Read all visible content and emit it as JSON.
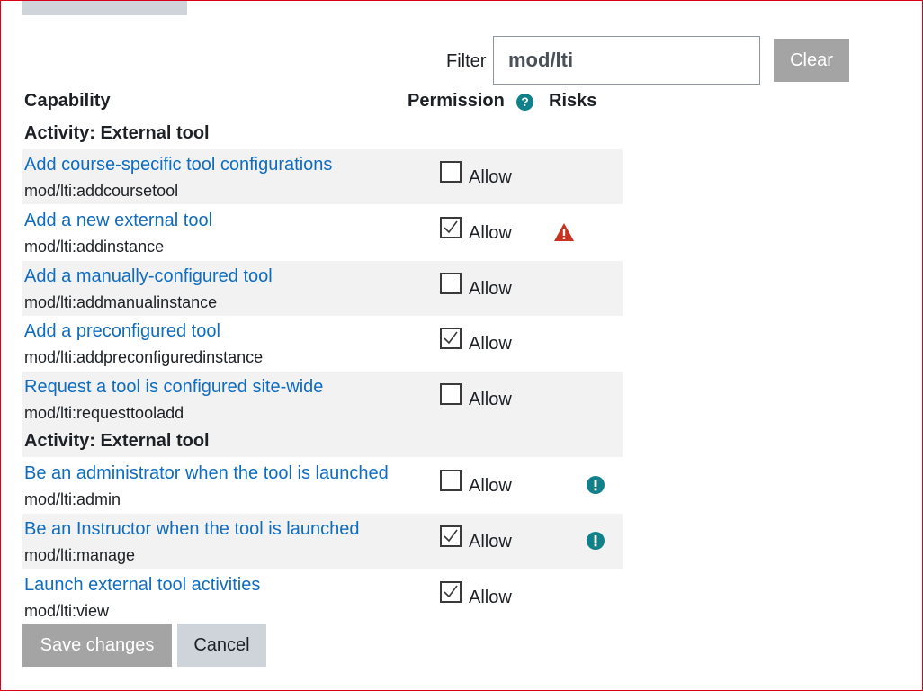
{
  "filter": {
    "label": "Filter",
    "value": "mod/lti",
    "clear_label": "Clear"
  },
  "table": {
    "headers": {
      "capability": "Capability",
      "permission": "Permission",
      "risks": "Risks"
    },
    "groups": [
      {
        "title": "Activity: External tool"
      },
      {
        "title": "Activity: External tool"
      }
    ],
    "rows": [
      {
        "name": "Add course-specific tool configurations",
        "code": "mod/lti:addcoursetool",
        "allow_label": "Allow",
        "checked": false,
        "risk": ""
      },
      {
        "name": "Add a new external tool",
        "code": "mod/lti:addinstance",
        "allow_label": "Allow",
        "checked": true,
        "risk": "warning-triangle-icon"
      },
      {
        "name": "Add a manually-configured tool",
        "code": "mod/lti:addmanualinstance",
        "allow_label": "Allow",
        "checked": false,
        "risk": ""
      },
      {
        "name": "Add a preconfigured tool",
        "code": "mod/lti:addpreconfiguredinstance",
        "allow_label": "Allow",
        "checked": true,
        "risk": ""
      },
      {
        "name": "Request a tool is configured site-wide",
        "code": "mod/lti:requesttooladd",
        "allow_label": "Allow",
        "checked": false,
        "risk": ""
      },
      {
        "name": "Be an administrator when the tool is launched",
        "code": "mod/lti:admin",
        "allow_label": "Allow",
        "checked": false,
        "risk": "info-exclamation-icon"
      },
      {
        "name": "Be an Instructor when the tool is launched",
        "code": "mod/lti:manage",
        "allow_label": "Allow",
        "checked": true,
        "risk": "info-exclamation-icon"
      },
      {
        "name": "Launch external tool activities",
        "code": "mod/lti:view",
        "allow_label": "Allow",
        "checked": true,
        "risk": ""
      }
    ]
  },
  "actions": {
    "save_label": "Save changes",
    "cancel_label": "Cancel"
  },
  "colors": {
    "link": "#0f6cbf",
    "risk_warning": "#ca3120",
    "risk_info": "#10818a",
    "row_shade": "#f2f2f2"
  }
}
